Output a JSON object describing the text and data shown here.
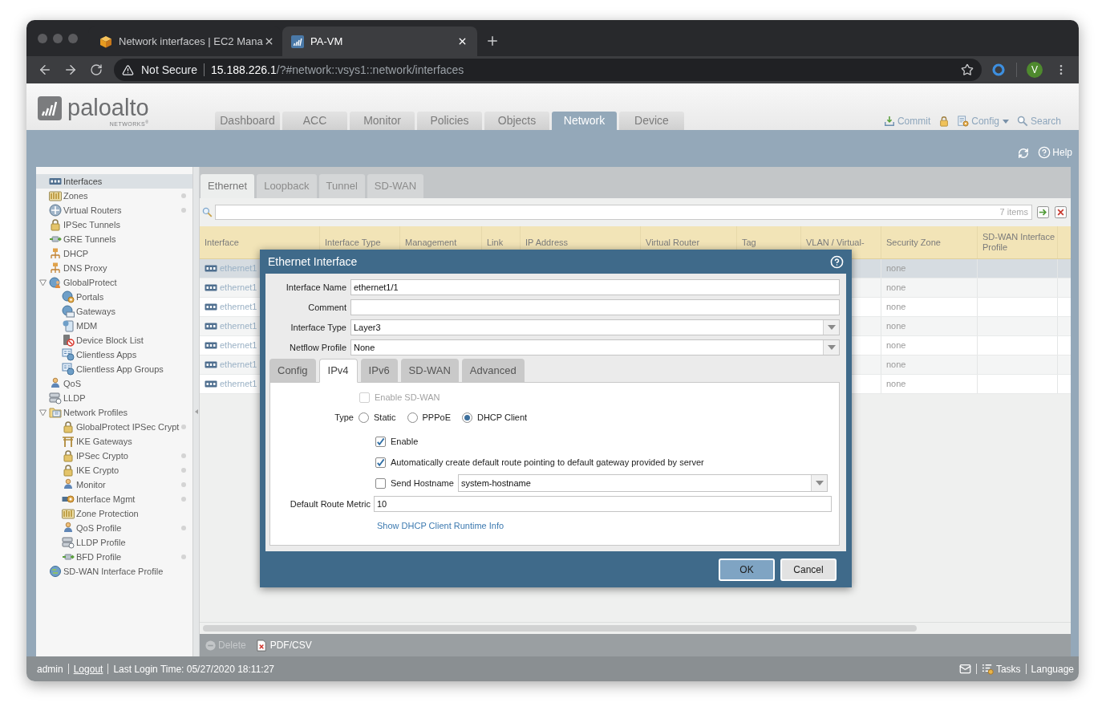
{
  "browser": {
    "tabs": [
      {
        "title": "Network interfaces | EC2 Mana",
        "selected": false
      },
      {
        "title": "PA-VM",
        "selected": true
      }
    ],
    "address_bar": {
      "security_label": "Not Secure",
      "host": "15.188.226.1",
      "path": "/?#network::vsys1::network/interfaces"
    },
    "profile_initial": "V"
  },
  "header": {
    "logo": {
      "wordmark": "paloalto",
      "tagline": "NETWORKS$^{®}$"
    },
    "nav_tabs": [
      {
        "label": "Dashboard",
        "selected": false
      },
      {
        "label": "ACC",
        "selected": false
      },
      {
        "label": "Monitor",
        "selected": false
      },
      {
        "label": "Policies",
        "selected": false
      },
      {
        "label": "Objects",
        "selected": false
      },
      {
        "label": "Network",
        "selected": true
      },
      {
        "label": "Device",
        "selected": false
      }
    ],
    "actions": [
      {
        "kind": "commit",
        "label": "Commit"
      },
      {
        "kind": "lock"
      },
      {
        "kind": "config",
        "label": "Config"
      },
      {
        "kind": "search",
        "label": "Search"
      }
    ],
    "help_label": "Help"
  },
  "sidebar": {
    "items": [
      {
        "label": "Interfaces",
        "selected": true,
        "dot": false
      },
      {
        "label": "Zones",
        "selected": false,
        "dot": true
      },
      {
        "label": "Virtual Routers",
        "selected": false,
        "dot": true
      },
      {
        "label": "IPSec Tunnels",
        "selected": false,
        "dot": false
      },
      {
        "label": "GRE Tunnels",
        "selected": false,
        "dot": false
      },
      {
        "label": "DHCP",
        "selected": false,
        "dot": false
      },
      {
        "label": "DNS Proxy",
        "selected": false,
        "dot": false
      },
      {
        "label": "GlobalProtect",
        "selected": false,
        "dot": false,
        "expanded": true,
        "children": [
          {
            "label": "Portals",
            "selected": false,
            "dot": false
          },
          {
            "label": "Gateways",
            "selected": false,
            "dot": false
          },
          {
            "label": "MDM",
            "selected": false,
            "dot": false
          },
          {
            "label": "Device Block List",
            "selected": false,
            "dot": false
          },
          {
            "label": "Clientless Apps",
            "selected": false,
            "dot": false
          },
          {
            "label": "Clientless App Groups",
            "selected": false,
            "dot": false
          }
        ]
      },
      {
        "label": "QoS",
        "selected": false,
        "dot": false
      },
      {
        "label": "LLDP",
        "selected": false,
        "dot": false
      },
      {
        "label": "Network Profiles",
        "selected": false,
        "dot": false,
        "expanded": true,
        "children": [
          {
            "label": "GlobalProtect IPSec Crypt",
            "selected": false,
            "dot": true
          },
          {
            "label": "IKE Gateways",
            "selected": false,
            "dot": false
          },
          {
            "label": "IPSec Crypto",
            "selected": false,
            "dot": true
          },
          {
            "label": "IKE Crypto",
            "selected": false,
            "dot": true
          },
          {
            "label": "Monitor",
            "selected": false,
            "dot": true
          },
          {
            "label": "Interface Mgmt",
            "selected": false,
            "dot": true
          },
          {
            "label": "Zone Protection",
            "selected": false,
            "dot": false
          },
          {
            "label": "QoS Profile",
            "selected": false,
            "dot": true
          },
          {
            "label": "LLDP Profile",
            "selected": false,
            "dot": false
          },
          {
            "label": "BFD Profile",
            "selected": false,
            "dot": true
          }
        ]
      },
      {
        "label": "SD-WAN Interface Profile",
        "selected": false,
        "dot": false
      }
    ]
  },
  "interface_tabs": [
    {
      "label": "Ethernet",
      "selected": true
    },
    {
      "label": "Loopback",
      "selected": false
    },
    {
      "label": "Tunnel",
      "selected": false
    },
    {
      "label": "SD-WAN",
      "selected": false
    }
  ],
  "filter": {
    "item_count": "7 items"
  },
  "table": {
    "columns": [
      "Interface",
      "Interface Type",
      "Management",
      "Link",
      "IP Address",
      "Virtual Router",
      "Tag",
      "VLAN / Virtual-",
      "Security Zone",
      "SD-WAN Interface Profile"
    ],
    "rows": [
      {
        "interface": "ethernet1",
        "security_zone": "none",
        "selected": true
      },
      {
        "interface": "ethernet1",
        "security_zone": "none",
        "selected": false
      },
      {
        "interface": "ethernet1",
        "security_zone": "none",
        "selected": false
      },
      {
        "interface": "ethernet1",
        "security_zone": "none",
        "selected": false
      },
      {
        "interface": "ethernet1",
        "security_zone": "none",
        "selected": false
      },
      {
        "interface": "ethernet1",
        "security_zone": "none",
        "selected": false
      },
      {
        "interface": "ethernet1",
        "security_zone": "none",
        "selected": false
      }
    ]
  },
  "actions": [
    {
      "kind": "delete",
      "label": "Delete",
      "disabled": true
    },
    {
      "kind": "export",
      "label": "PDF/CSV",
      "disabled": false
    }
  ],
  "status_bar": {
    "user": "admin",
    "logout": "Logout",
    "last_login": "Last Login Time: 05/27/2020 18:11:27",
    "tasks": "Tasks",
    "language": "Language"
  },
  "dialog": {
    "title": "Ethernet Interface",
    "fields": [
      {
        "kind": "text",
        "label": "Interface Name",
        "value": "ethernet1/1"
      },
      {
        "kind": "text",
        "label": "Comment"
      },
      {
        "kind": "select",
        "label": "Interface Type",
        "value": "Layer3"
      },
      {
        "kind": "select",
        "label": "Netflow Profile",
        "value": "None"
      }
    ],
    "tabs": [
      {
        "label": "Config",
        "selected": false
      },
      {
        "label": "IPv4",
        "selected": true
      },
      {
        "label": "IPv6",
        "selected": false
      },
      {
        "label": "SD-WAN",
        "selected": false
      },
      {
        "label": "Advanced",
        "selected": false
      }
    ],
    "ipv4": {
      "enable_sdwan": {
        "label": "Enable SD-WAN",
        "checked": false,
        "disabled": true
      },
      "type": {
        "label": "Type",
        "options": [
          {
            "label": "Static",
            "selected": false
          },
          {
            "label": "PPPoE",
            "selected": false
          },
          {
            "label": "DHCP Client",
            "selected": true
          }
        ]
      },
      "enable": {
        "label": "Enable",
        "checked": true
      },
      "default_route": {
        "label": "Automatically create default route pointing to default gateway provided by server",
        "checked": true
      },
      "send_hostname": {
        "label": "Send Hostname",
        "checked": false,
        "value": "system-hostname"
      },
      "metric": {
        "label": "Default Route Metric",
        "value": "10"
      },
      "runtime_link": "Show DHCP Client Runtime Info"
    },
    "buttons": [
      {
        "kind": "primary",
        "label": "OK"
      },
      {
        "kind": "secondary",
        "label": "Cancel"
      }
    ]
  }
}
